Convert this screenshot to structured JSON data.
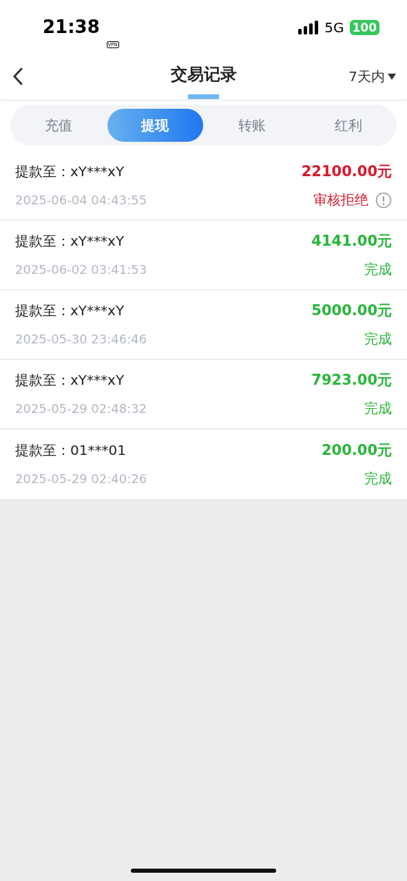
{
  "status_bar": {
    "time": "21:38",
    "vpn": "VPN",
    "network": "5G",
    "battery": "100"
  },
  "header": {
    "title": "交易记录",
    "filter": "7天内"
  },
  "tabs": [
    {
      "label": "充值",
      "selected": false
    },
    {
      "label": "提现",
      "selected": true
    },
    {
      "label": "转账",
      "selected": false
    },
    {
      "label": "红利",
      "selected": false
    }
  ],
  "records": [
    {
      "account": "提款至：xY***xY",
      "amount": "22100.00元",
      "time": "2025-06-04 04:43:55",
      "status": "审核拒绝",
      "kind": "rejected"
    },
    {
      "account": "提款至：xY***xY",
      "amount": "4141.00元",
      "time": "2025-06-02 03:41:53",
      "status": "完成",
      "kind": "done"
    },
    {
      "account": "提款至：xY***xY",
      "amount": "5000.00元",
      "time": "2025-05-30 23:46:46",
      "status": "完成",
      "kind": "done"
    },
    {
      "account": "提款至：xY***xY",
      "amount": "7923.00元",
      "time": "2025-05-29 02:48:32",
      "status": "完成",
      "kind": "done"
    },
    {
      "account": "提款至：01***01",
      "amount": "200.00元",
      "time": "2025-05-29 02:40:26",
      "status": "完成",
      "kind": "done"
    }
  ]
}
